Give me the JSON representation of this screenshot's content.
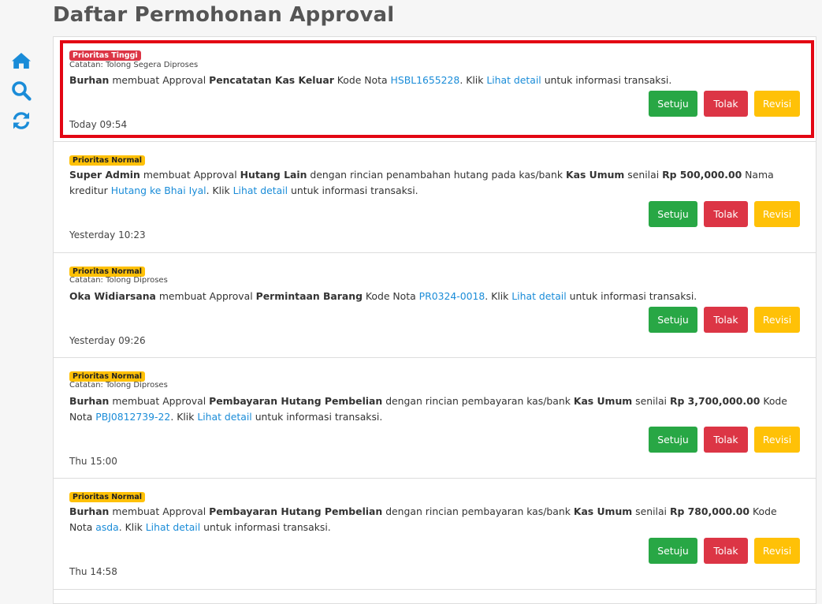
{
  "page": {
    "title": "Daftar Permohonan Approval"
  },
  "sidebar": [
    {
      "icon": "home-icon"
    },
    {
      "icon": "search-icon"
    },
    {
      "icon": "refresh-icon"
    }
  ],
  "colors": {
    "accent": "#1a8cd8",
    "approve": "#28a745",
    "reject": "#dc3545",
    "revise": "#ffc107",
    "highlight": "#e30613"
  },
  "buttons": {
    "approve": "Setuju",
    "reject": "Tolak",
    "revise": "Revisi"
  },
  "items": [
    {
      "priority": "Prioritas Tinggi",
      "note": "Catatan: Tolong Segera Diproses",
      "user": "Burhan",
      "t1": " membuat Approval ",
      "module": "Pencatatan Kas Keluar",
      "t2": " Kode Nota ",
      "code": "HSBL1655228",
      "t3": ". Klik ",
      "link": "Lihat detail",
      "t4": " untuk informasi transaksi.",
      "time": "Today 09:54"
    },
    {
      "priority": "Prioritas Normal",
      "user": "Super Admin",
      "t1": " membuat Approval ",
      "module": "Hutang Lain",
      "t2": " dengan rincian penambahan hutang pada kas/bank ",
      "bank": "Kas Umum",
      "t3": " senilai ",
      "amount": "Rp 500,000.00",
      "t4": " Nama kreditur ",
      "creditor": "Hutang ke Bhai Iyal",
      "t5": ". Klik ",
      "link": "Lihat detail",
      "t6": " untuk informasi transaksi.",
      "time": "Yesterday 10:23"
    },
    {
      "priority": "Prioritas Normal",
      "note": "Catatan: Tolong Diproses",
      "user": "Oka Widiarsana",
      "t1": " membuat Approval ",
      "module": "Permintaan Barang",
      "t2": " Kode Nota ",
      "code": "PR0324-0018",
      "t3": ". Klik ",
      "link": "Lihat detail",
      "t4": " untuk informasi transaksi.",
      "time": "Yesterday 09:26"
    },
    {
      "priority": "Prioritas Normal",
      "note": "Catatan: Tolong Diproses",
      "user": "Burhan",
      "t1": " membuat Approval ",
      "module": "Pembayaran Hutang Pembelian",
      "t2": " dengan rincian pembayaran kas/bank ",
      "bank": "Kas Umum",
      "t3": " senilai ",
      "amount": "Rp 3,700,000.00",
      "t4": " Kode Nota ",
      "code": "PBJ0812739-22",
      "t5": ". Klik ",
      "link": "Lihat detail",
      "t6": " untuk informasi transaksi.",
      "time": "Thu 15:00"
    },
    {
      "priority": "Prioritas Normal",
      "user": "Burhan",
      "t1": " membuat Approval ",
      "module": "Pembayaran Hutang Pembelian",
      "t2": " dengan rincian pembayaran kas/bank ",
      "bank": "Kas Umum",
      "t3": " senilai ",
      "amount": "Rp 780,000.00",
      "t4": " Kode Nota ",
      "code": "asda",
      "t5": ". Klik ",
      "link": "Lihat detail",
      "t6": " untuk informasi transaksi.",
      "time": "Thu 14:58"
    }
  ]
}
